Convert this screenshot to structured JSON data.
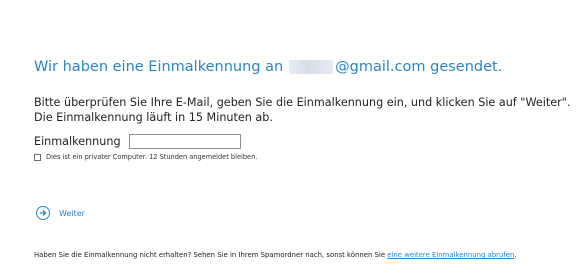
{
  "heading": {
    "prefix": "Wir haben eine Einmalkennung an",
    "suffix": "@gmail.com gesendet."
  },
  "description": "Bitte überprüfen Sie Ihre E-Mail, geben Sie die Einmalkennung ein, und klicken Sie auf \"Weiter\". Die Einmalkennung läuft in 15 Minuten ab.",
  "code_field": {
    "label": "Einmalkennung",
    "value": ""
  },
  "remember_checkbox": {
    "label": "Dies ist ein privater Computer. 12 Stunden angemeldet bleiben.",
    "checked": false
  },
  "next_button": {
    "label": "Weiter",
    "icon": "arrow-right-circle-icon"
  },
  "footer": {
    "text": "Haben Sie die Einmalkennung nicht erhalten? Sehen Sie in Ihrem Spamordner nach, sonst können Sie ",
    "link_label": "eine weitere Einmalkennung abrufen",
    "end": "."
  },
  "colors": {
    "accent": "#2a86c6",
    "text": "#222222"
  }
}
